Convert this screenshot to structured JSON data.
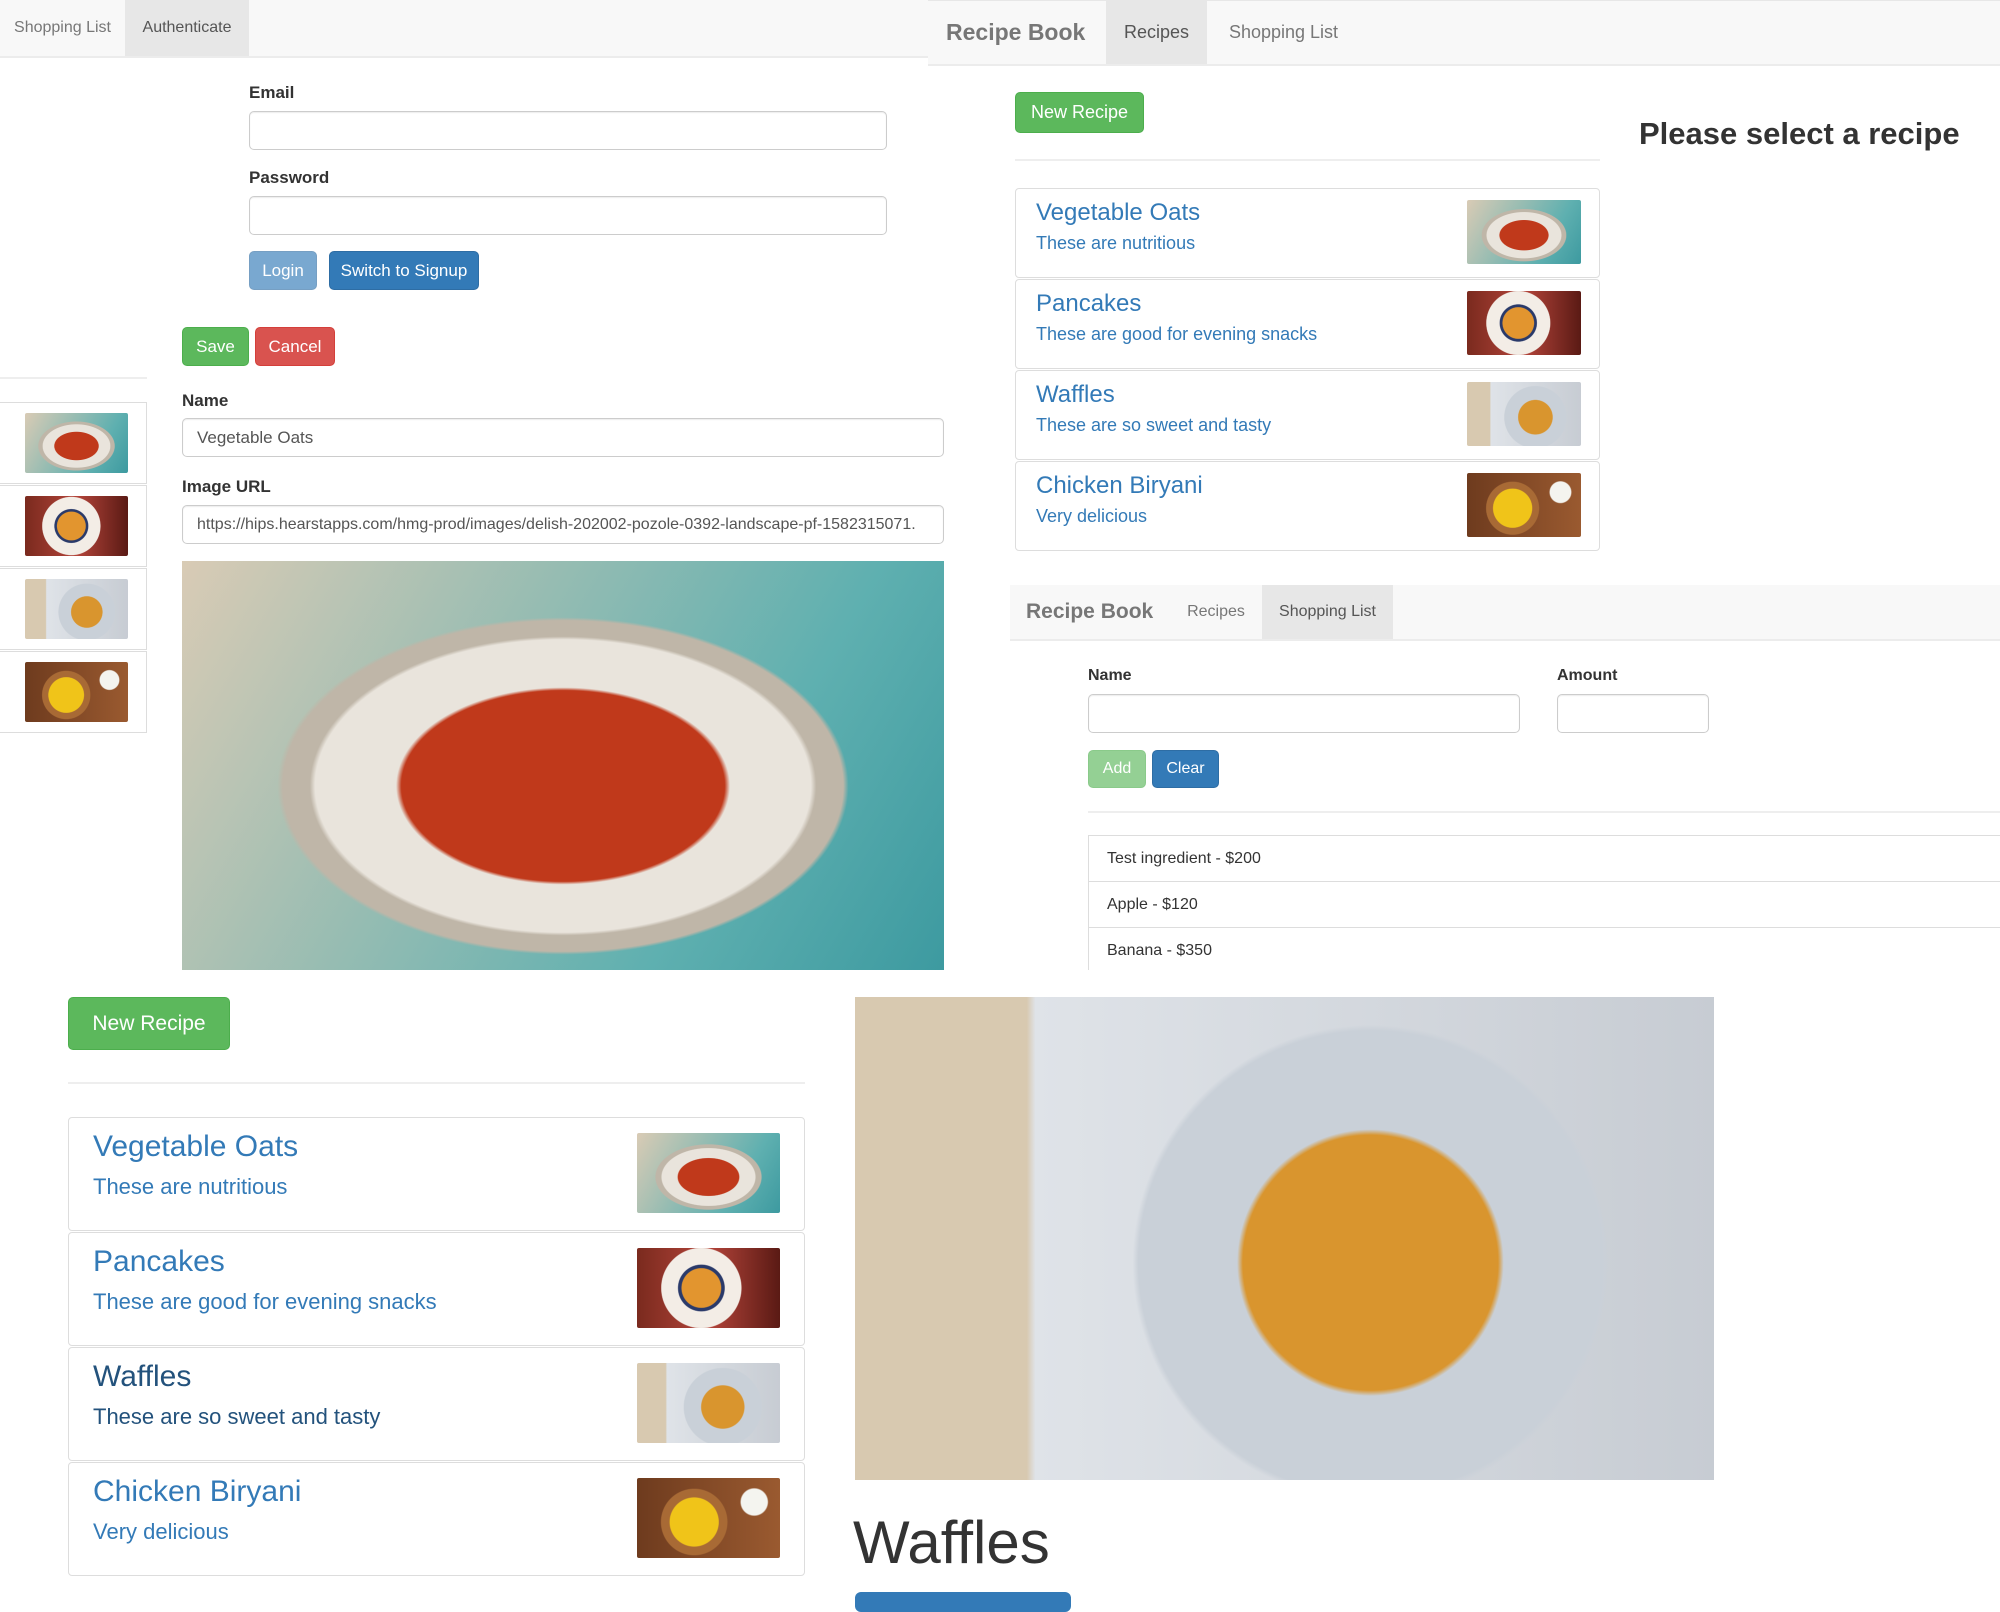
{
  "auth_panel": {
    "tabs": [
      {
        "label": "Shopping List",
        "active": false
      },
      {
        "label": "Authenticate",
        "active": true
      }
    ],
    "email_label": "Email",
    "email_value": "",
    "password_label": "Password",
    "password_value": "",
    "login_label": "Login",
    "switch_label": "Switch to Signup"
  },
  "edit_panel": {
    "save_label": "Save",
    "cancel_label": "Cancel",
    "name_label": "Name",
    "name_value": "Vegetable Oats",
    "image_url_label": "Image URL",
    "image_url_value": "https://hips.hearstapps.com/hmg-prod/images/delish-202002-pozole-0392-landscape-pf-1582315071.",
    "thumbnails": [
      "soup",
      "pancake",
      "waffle",
      "biryani"
    ]
  },
  "recipes_panel": {
    "brand": "Recipe Book",
    "tabs": [
      {
        "label": "Recipes",
        "active": true
      },
      {
        "label": "Shopping List",
        "active": false
      }
    ],
    "new_recipe_label": "New Recipe",
    "placeholder_message": "Please select a recipe"
  },
  "recipes": [
    {
      "name": "Vegetable Oats",
      "description": "These are nutritious",
      "image": "soup"
    },
    {
      "name": "Pancakes",
      "description": "These are good for evening snacks",
      "image": "pancake"
    },
    {
      "name": "Waffles",
      "description": "These are so sweet and tasty",
      "image": "waffle"
    },
    {
      "name": "Chicken Biryani",
      "description": "Very delicious",
      "image": "biryani"
    }
  ],
  "shopping_panel": {
    "brand": "Recipe Book",
    "tabs": [
      {
        "label": "Recipes",
        "active": false
      },
      {
        "label": "Shopping List",
        "active": true
      }
    ],
    "name_label": "Name",
    "amount_label": "Amount",
    "name_value": "",
    "amount_value": "",
    "add_label": "Add",
    "clear_label": "Clear",
    "ingredients": [
      "Test ingredient - $200",
      "Apple - $120",
      "Banana - $350"
    ]
  },
  "detail_panel": {
    "new_recipe_label": "New Recipe",
    "selected_title": "Waffles",
    "hovered_item": "Waffles"
  },
  "colors": {
    "primary": "#337ab7",
    "success": "#5cb85c",
    "danger": "#d9534f",
    "navbar": "#f8f8f8"
  }
}
